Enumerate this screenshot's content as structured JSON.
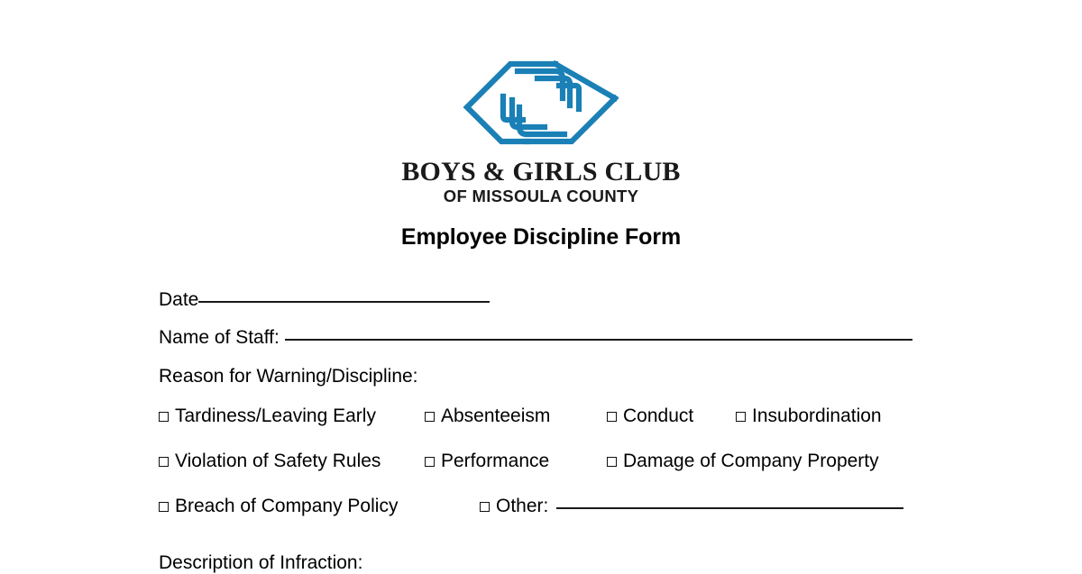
{
  "document": {
    "background_color": "#ffffff",
    "text_color": "#000000",
    "brand_blue": "#1a80b6"
  },
  "logo": {
    "mark_name": "boys-and-girls-club-hands-logo",
    "wordmark": "BOYS & GIRLS CLUB",
    "subwordmark": "OF MISSOULA COUNTY"
  },
  "title": "Employee Discipline Form",
  "fields": {
    "date_label": "Date",
    "name_label": "Name of Staff: ",
    "reason_label": "Reason for Warning/Discipline:"
  },
  "checkboxes": {
    "row1": [
      {
        "label": "Tardiness/Leaving Early",
        "checked": false
      },
      {
        "label": "Absenteeism",
        "checked": false
      },
      {
        "label": "Conduct",
        "checked": false
      },
      {
        "label": "Insubordination",
        "checked": false
      }
    ],
    "row2": [
      {
        "label": "Violation of Safety Rules",
        "checked": false
      },
      {
        "label": "Performance",
        "checked": false
      },
      {
        "label": "Damage of Company Property",
        "checked": false
      }
    ],
    "row3": [
      {
        "label": "Breach of Company Policy",
        "checked": false
      },
      {
        "label": "Other:",
        "checked": false
      }
    ]
  },
  "footer_clipped": {
    "label": "Description of Infraction:"
  }
}
